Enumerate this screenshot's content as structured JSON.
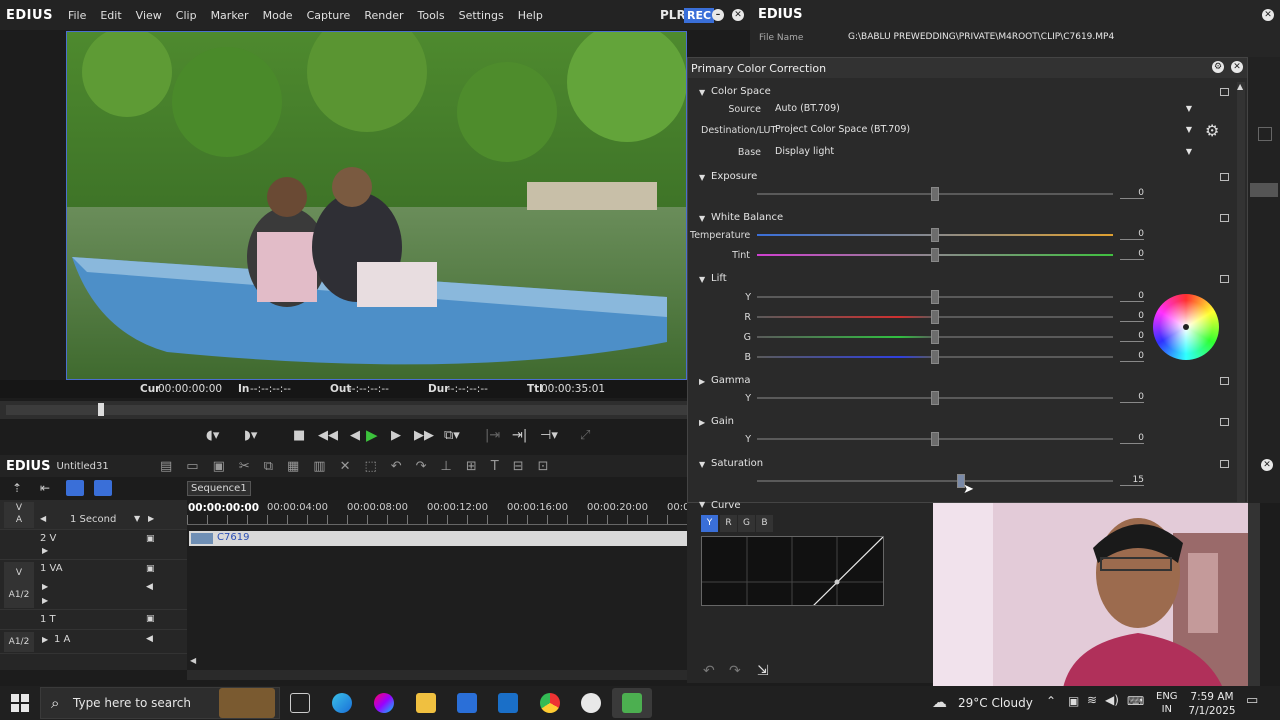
{
  "app": {
    "name": "EDIUS",
    "menu": [
      "File",
      "Edit",
      "View",
      "Clip",
      "Marker",
      "Mode",
      "Capture",
      "Render",
      "Tools",
      "Settings",
      "Help"
    ],
    "plr": "PLR",
    "rec": "REC"
  },
  "timecode": {
    "cur_label": "Cur",
    "cur": "00:00:00:00",
    "in_label": "In",
    "in": "--:--:--:--",
    "out_label": "Out",
    "out": "--:--:--:--",
    "dur_label": "Dur",
    "dur": "--:--:--:--",
    "ttl_label": "Ttl",
    "ttl": "00:00:35:01"
  },
  "timeline": {
    "app_name": "EDIUS",
    "project": "Untitled31",
    "sequence_tab": "Sequence1",
    "scale": "1 Second",
    "current_time": "00:00:00:00",
    "ruler": [
      "00:00:04:00",
      "00:00:08:00",
      "00:00:12:00",
      "00:00:16:00",
      "00:00:20:00",
      "00:0"
    ],
    "tracks": [
      {
        "toggle": "V",
        "name": "2 V"
      },
      {
        "toggle": "V",
        "name": "1 VA",
        "sub": "A1/2"
      },
      {
        "toggle": "",
        "name": "1 T"
      },
      {
        "toggle": "A1/2",
        "name": "1 A"
      }
    ],
    "tracks_top_toggle": "V",
    "tracks_top_toggle2": "A",
    "clip_name": "C7619"
  },
  "fileinfo": {
    "title": "EDIUS",
    "file_label": "File Name",
    "file_value": "G:\\BABLU PREWEDDING\\PRIVATE\\M4ROOT\\CLIP\\C7619.MP4"
  },
  "pcc": {
    "title": "Primary Color Correction",
    "color_space": {
      "title": "Color Space",
      "source_label": "Source",
      "source": "Auto (BT.709)",
      "dest_label": "Destination/LUT",
      "dest": "Project Color Space (BT.709)",
      "base_label": "Base",
      "base": "Display light"
    },
    "exposure": {
      "title": "Exposure",
      "value": "0"
    },
    "white_balance": {
      "title": "White Balance",
      "temp_label": "Temperature",
      "temp": "0",
      "tint_label": "Tint",
      "tint": "0"
    },
    "lift": {
      "title": "Lift",
      "y_label": "Y",
      "y": "0",
      "r_label": "R",
      "r": "0",
      "g_label": "G",
      "g": "0",
      "b_label": "B",
      "b": "0"
    },
    "gamma": {
      "title": "Gamma",
      "y_label": "Y",
      "y": "0"
    },
    "gain": {
      "title": "Gain",
      "y_label": "Y",
      "y": "0"
    },
    "saturation": {
      "title": "Saturation",
      "value": "15",
      "level": 0.58
    },
    "curve": {
      "title": "Curve",
      "channels": [
        "Y",
        "R",
        "G",
        "B"
      ]
    }
  },
  "taskbar": {
    "search_placeholder": "Type here to search",
    "weather": "29°C  Cloudy",
    "lang1": "ENG",
    "lang2": "IN",
    "time": "7:59 AM",
    "date": "7/1/2025"
  },
  "colors": {
    "accent": "#3a6fd8",
    "temp_start": "#3a6fd8",
    "temp_end": "#e0a030",
    "tint_start": "#d040d0",
    "tint_end": "#40c040"
  }
}
